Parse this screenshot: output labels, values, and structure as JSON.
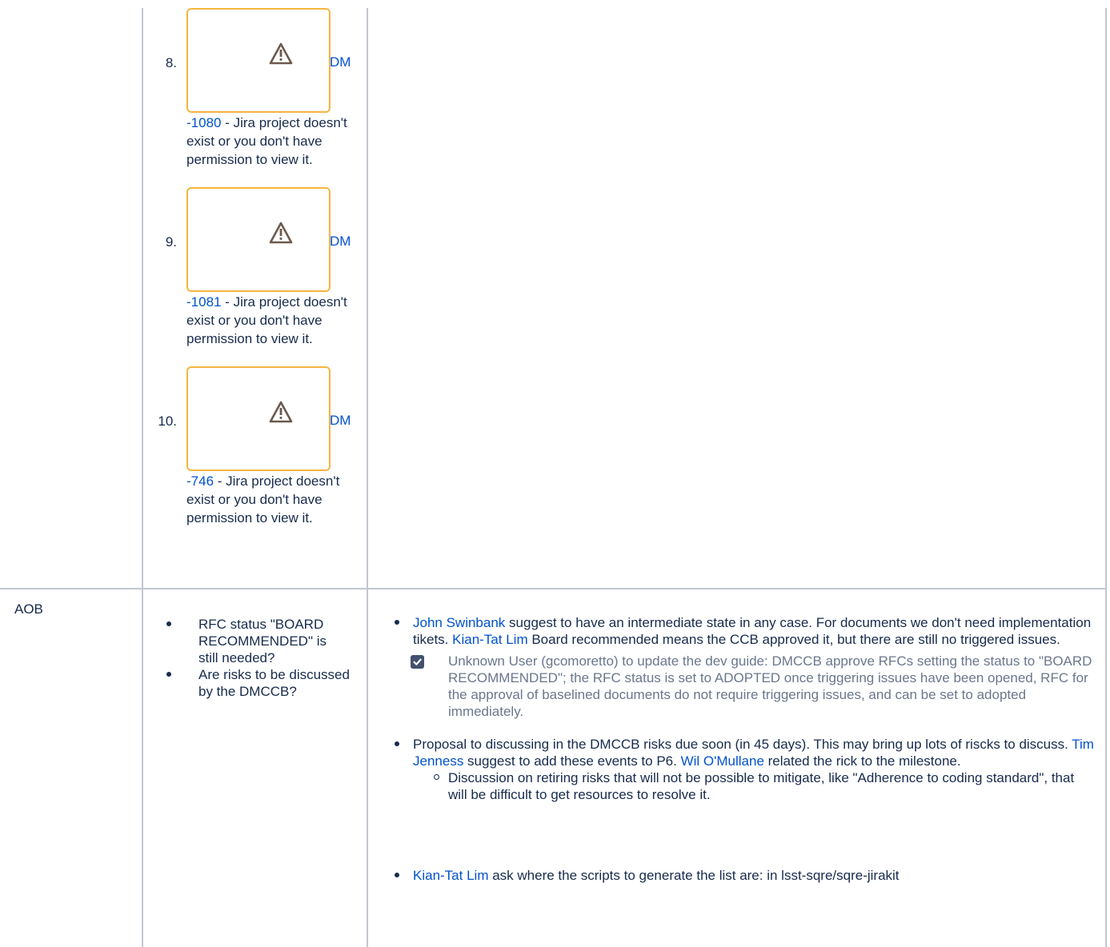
{
  "jira_items": [
    {
      "number": "8.",
      "project": "DM",
      "issue": "-1080",
      "message": " - Jira project doesn't exist or you don't have permission to view it."
    },
    {
      "number": "9.",
      "project": "DM",
      "issue": "-1081",
      "message": " - Jira project doesn't exist or you don't have permission to view it."
    },
    {
      "number": "10.",
      "project": "DM",
      "issue": "-746",
      "message": " - Jira project doesn't exist or you don't have permission to view it."
    }
  ],
  "aob": {
    "label": "AOB",
    "topics": [
      "RFC status \"BOARD RECOMMENDED\" is still needed?",
      "Are risks to be discussed by the DMCCB?"
    ],
    "notes": {
      "n1": {
        "user1": "John Swinbank",
        "text1": " suggest to have an intermediate state in any case. For documents we don't need implementation tikets. ",
        "user2": "Kian-Tat Lim",
        "text2": " Board recommended means the CCB approved it, but there are still no triggered issues."
      },
      "task": {
        "checked": true,
        "text": "Unknown User (gcomoretto) to update the dev guide: DMCCB approve RFCs setting the status to \"BOARD RECOMMENDED\"; the RFC status is set to ADOPTED once triggering issues have been opened, RFC for the approval of baselined documents do not require triggering issues, and can be set to adopted immediately."
      },
      "n2": {
        "text1": "Proposal to discussing in the DMCCB risks due soon (in 45 days). This may bring up lots of riscks to discuss. ",
        "user1": "Tim Jenness",
        "text2": " suggest to add these events to P6. ",
        "user2": "Wil O'Mullane",
        "text3": " related the rick to the milestone.",
        "sub": "Discussion on retiring risks that will not be possible to mitigate, like \"Adherence to coding standard\", that will be difficult to get resources to resolve it."
      },
      "n3": {
        "user1": "Kian-Tat Lim",
        "text1": " ask where the scripts to generate the list are: in lsst-sqre/sqre-jirakit"
      }
    }
  },
  "colors": {
    "link": "#0052cc",
    "border": "#c1c7d0",
    "jira_box": "#f6b53f",
    "task_text": "#6b778c"
  },
  "icons": {
    "jira": "warning-icon",
    "task": "checkbox-checked-icon"
  }
}
